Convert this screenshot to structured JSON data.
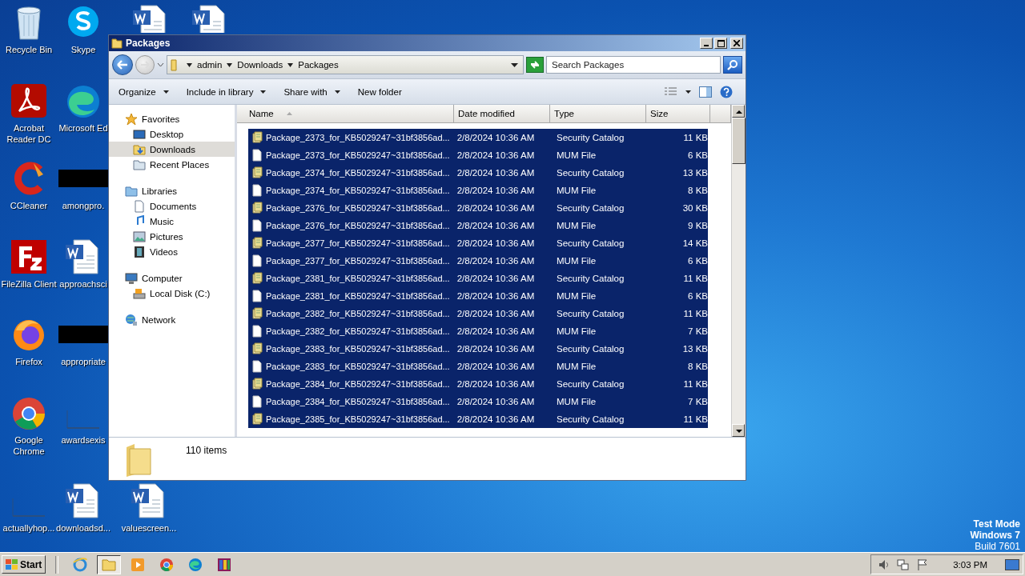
{
  "desktop": {
    "icons": [
      {
        "label": "Recycle Bin",
        "kind": "recycle"
      },
      {
        "label": "Acrobat Reader DC",
        "kind": "acrobat"
      },
      {
        "label": "CCleaner",
        "kind": "ccleaner"
      },
      {
        "label": "FileZilla Client",
        "kind": "filezilla"
      },
      {
        "label": "Firefox",
        "kind": "firefox"
      },
      {
        "label": "Google Chrome",
        "kind": "chrome"
      },
      {
        "label": "actuallyhop...",
        "kind": "blank"
      },
      {
        "label": "Skype",
        "kind": "skype"
      },
      {
        "label": "Microsoft Ed",
        "kind": "edge"
      },
      {
        "label": "amongpro.",
        "kind": "redacted"
      },
      {
        "label": "approachsci",
        "kind": "word"
      },
      {
        "label": "appropriate",
        "kind": "redacted"
      },
      {
        "label": "awardsexis",
        "kind": "blank"
      },
      {
        "label": "downloadsd...",
        "kind": "word"
      },
      {
        "kind": "word"
      },
      {
        "label": "valuescreen...",
        "kind": "word"
      },
      {
        "kind": "word"
      }
    ],
    "watermark": [
      "Test Mode",
      "Windows 7",
      "Build 7601"
    ]
  },
  "window": {
    "title": "Packages",
    "breadcrumb": [
      "admin",
      "Downloads",
      "Packages"
    ],
    "search": {
      "placeholder": "Search Packages"
    },
    "toolbar": [
      {
        "label": "Organize",
        "dropdown": true
      },
      {
        "label": "Include in library",
        "dropdown": true
      },
      {
        "label": "Share with",
        "dropdown": true
      },
      {
        "label": "New folder",
        "dropdown": false
      }
    ],
    "navigation": [
      {
        "label": "Favorites",
        "kind": "star",
        "selected": false,
        "children": [
          {
            "label": "Desktop",
            "kind": "desktop",
            "selected": false
          },
          {
            "label": "Downloads",
            "kind": "downloads",
            "selected": true
          },
          {
            "label": "Recent Places",
            "kind": "recent",
            "selected": false
          }
        ]
      },
      {
        "label": "Libraries",
        "kind": "libraries",
        "selected": false,
        "children": [
          {
            "label": "Documents",
            "kind": "documents",
            "selected": false
          },
          {
            "label": "Music",
            "kind": "music",
            "selected": false
          },
          {
            "label": "Pictures",
            "kind": "pictures",
            "selected": false
          },
          {
            "label": "Videos",
            "kind": "videos",
            "selected": false
          }
        ]
      },
      {
        "label": "Computer",
        "kind": "computer",
        "selected": false,
        "children": [
          {
            "label": "Local Disk (C:)",
            "kind": "disk",
            "selected": false
          }
        ]
      },
      {
        "label": "Network",
        "kind": "network",
        "selected": false
      }
    ],
    "columns": [
      "Name",
      "Date modified",
      "Type",
      "Size"
    ],
    "files": [
      {
        "name": "Package_2373_for_KB5029247~31bf3856ad...",
        "date": "2/8/2024 10:36 AM",
        "type": "Security Catalog",
        "size": "11 KB",
        "kind": "catalog",
        "selected": true
      },
      {
        "name": "Package_2373_for_KB5029247~31bf3856ad...",
        "date": "2/8/2024 10:36 AM",
        "type": "MUM File",
        "size": "6 KB",
        "kind": "file",
        "selected": true
      },
      {
        "name": "Package_2374_for_KB5029247~31bf3856ad...",
        "date": "2/8/2024 10:36 AM",
        "type": "Security Catalog",
        "size": "13 KB",
        "kind": "catalog",
        "selected": true
      },
      {
        "name": "Package_2374_for_KB5029247~31bf3856ad...",
        "date": "2/8/2024 10:36 AM",
        "type": "MUM File",
        "size": "8 KB",
        "kind": "file",
        "selected": true
      },
      {
        "name": "Package_2376_for_KB5029247~31bf3856ad...",
        "date": "2/8/2024 10:36 AM",
        "type": "Security Catalog",
        "size": "30 KB",
        "kind": "catalog",
        "selected": true
      },
      {
        "name": "Package_2376_for_KB5029247~31bf3856ad...",
        "date": "2/8/2024 10:36 AM",
        "type": "MUM File",
        "size": "9 KB",
        "kind": "file",
        "selected": true
      },
      {
        "name": "Package_2377_for_KB5029247~31bf3856ad...",
        "date": "2/8/2024 10:36 AM",
        "type": "Security Catalog",
        "size": "14 KB",
        "kind": "catalog",
        "selected": true
      },
      {
        "name": "Package_2377_for_KB5029247~31bf3856ad...",
        "date": "2/8/2024 10:36 AM",
        "type": "MUM File",
        "size": "6 KB",
        "kind": "file",
        "selected": true
      },
      {
        "name": "Package_2381_for_KB5029247~31bf3856ad...",
        "date": "2/8/2024 10:36 AM",
        "type": "Security Catalog",
        "size": "11 KB",
        "kind": "catalog",
        "selected": true
      },
      {
        "name": "Package_2381_for_KB5029247~31bf3856ad...",
        "date": "2/8/2024 10:36 AM",
        "type": "MUM File",
        "size": "6 KB",
        "kind": "file",
        "selected": true
      },
      {
        "name": "Package_2382_for_KB5029247~31bf3856ad...",
        "date": "2/8/2024 10:36 AM",
        "type": "Security Catalog",
        "size": "11 KB",
        "kind": "catalog",
        "selected": true
      },
      {
        "name": "Package_2382_for_KB5029247~31bf3856ad...",
        "date": "2/8/2024 10:36 AM",
        "type": "MUM File",
        "size": "7 KB",
        "kind": "file",
        "selected": true
      },
      {
        "name": "Package_2383_for_KB5029247~31bf3856ad...",
        "date": "2/8/2024 10:36 AM",
        "type": "Security Catalog",
        "size": "13 KB",
        "kind": "catalog",
        "selected": true
      },
      {
        "name": "Package_2383_for_KB5029247~31bf3856ad...",
        "date": "2/8/2024 10:36 AM",
        "type": "MUM File",
        "size": "8 KB",
        "kind": "file",
        "selected": true
      },
      {
        "name": "Package_2384_for_KB5029247~31bf3856ad...",
        "date": "2/8/2024 10:36 AM",
        "type": "Security Catalog",
        "size": "11 KB",
        "kind": "catalog",
        "selected": true
      },
      {
        "name": "Package_2384_for_KB5029247~31bf3856ad...",
        "date": "2/8/2024 10:36 AM",
        "type": "MUM File",
        "size": "7 KB",
        "kind": "file",
        "selected": true
      },
      {
        "name": "Package_2385_for_KB5029247~31bf3856ad...",
        "date": "2/8/2024 10:36 AM",
        "type": "Security Catalog",
        "size": "11 KB",
        "kind": "catalog",
        "selected": true
      }
    ],
    "status": "110 items"
  },
  "taskbar": {
    "start": "Start",
    "apps": [
      {
        "kind": "ie",
        "selected": false
      },
      {
        "kind": "explorer",
        "selected": true
      },
      {
        "kind": "media",
        "selected": false
      },
      {
        "kind": "chrome",
        "selected": false
      },
      {
        "kind": "edge",
        "selected": false
      },
      {
        "kind": "winrar",
        "selected": false
      }
    ],
    "clock": "3:03 PM"
  }
}
